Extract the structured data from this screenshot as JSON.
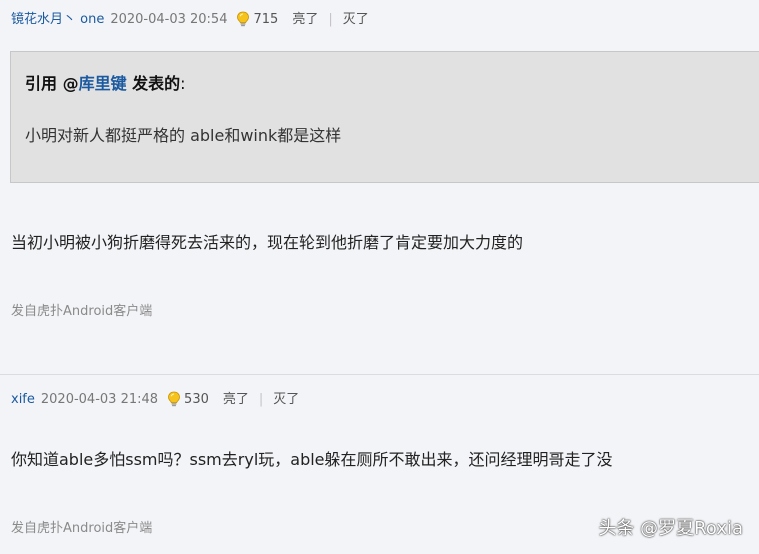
{
  "posts": [
    {
      "user": "镜花水月丶 one",
      "time": "2020-04-03 20:54",
      "light_count": "715",
      "light_label": "亮了",
      "separator": "|",
      "dark_label": "灭了",
      "quote": {
        "prefix": "引用 @",
        "user": "库里键",
        "suffix": " 发表的",
        "colon": ":",
        "text": "小明对新人都挺严格的 able和wink都是这样"
      },
      "content": "当初小明被小狗折磨得死去活来的，现在轮到他折磨了肯定要加大力度的",
      "source": "发自虎扑Android客户端"
    },
    {
      "user": "xife",
      "time": "2020-04-03 21:48",
      "light_count": "530",
      "light_label": "亮了",
      "separator": "|",
      "dark_label": "灭了",
      "content": "你知道able多怕ssm吗？ssm去ryl玩，able躲在厕所不敢出来，还问经理明哥走了没",
      "source": "发自虎扑Android客户端"
    }
  ],
  "watermark": "头条 @罗夏Roxia",
  "colors": {
    "background": "#f3f4f7",
    "username": "#1b5aa0",
    "quote_bg": "#e1e1e1",
    "bulb": "#f2b705"
  },
  "icons": {
    "light": "lightbulb-icon"
  }
}
